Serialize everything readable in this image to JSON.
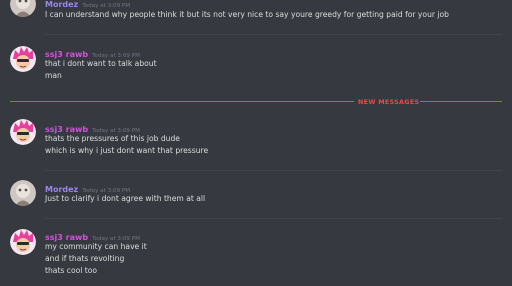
{
  "colors": {
    "background": "#36393f",
    "mordez_name": "#9b84ee",
    "ssj3_name": "#d650e0",
    "timestamp": "#72767d",
    "message_text": "#dcddde",
    "new_messages": "#f04747"
  },
  "divider": {
    "label": "NEW MESSAGES"
  },
  "messages": [
    {
      "author": "Mordez",
      "timestamp": "Today at 3:09 PM",
      "avatar_icon": "mordez-avatar-icon",
      "lines": [
        "I can understand why people think it but its not very nice to say youre greedy for getting paid for your job"
      ]
    },
    {
      "author": "ssj3 rawb",
      "timestamp": "Today at 3:09 PM",
      "avatar_icon": "pink-hair-avatar-icon",
      "lines": [
        "that i dont want to talk about",
        "man"
      ]
    },
    {
      "author": "ssj3 rawb",
      "timestamp": "Today at 3:09 PM",
      "avatar_icon": "pink-hair-avatar-icon",
      "lines": [
        "thats the pressures of this job dude",
        "which is why i just dont want that pressure"
      ]
    },
    {
      "author": "Mordez",
      "timestamp": "Today at 3:09 PM",
      "avatar_icon": "mordez-avatar-icon",
      "lines": [
        "Just to clarify i dont agree with them at all"
      ]
    },
    {
      "author": "ssj3 rawb",
      "timestamp": "Today at 3:09 PM",
      "avatar_icon": "pink-hair-avatar-icon",
      "lines": [
        "my community can have it",
        "and if thats revolting",
        "thats cool too"
      ]
    }
  ]
}
